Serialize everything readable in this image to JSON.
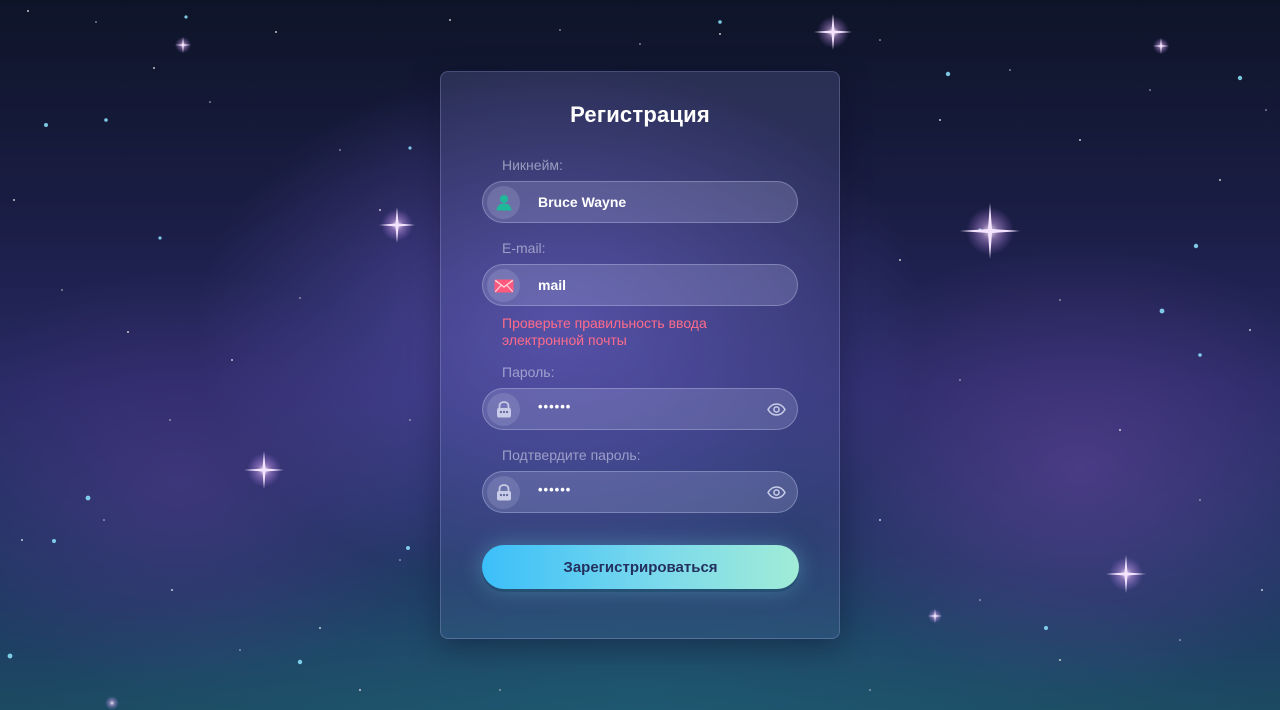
{
  "form": {
    "title": "Регистрация",
    "nickname": {
      "label": "Никнейм:",
      "value": "Bruce Wayne",
      "icon": "user-icon"
    },
    "email": {
      "label": "E-mail:",
      "value": "mail",
      "icon": "envelope-icon",
      "error": "Проверьте правильность ввода электронной почты"
    },
    "password": {
      "label": "Пароль:",
      "value": "••••••",
      "icon": "lock-icon",
      "toggle_icon": "eye-icon"
    },
    "confirm_password": {
      "label": "Подтвердите пароль:",
      "value": "••••••",
      "icon": "lock-icon",
      "toggle_icon": "eye-icon"
    },
    "submit_label": "Зарегистрироваться"
  },
  "colors": {
    "user_icon": "#1fb89a",
    "envelope_icon": "#ff5a7e",
    "error_text": "#ff6b8a",
    "button_gradient_start": "#3bbff9",
    "button_gradient_end": "#a1ecd6",
    "button_text": "#23305e"
  }
}
